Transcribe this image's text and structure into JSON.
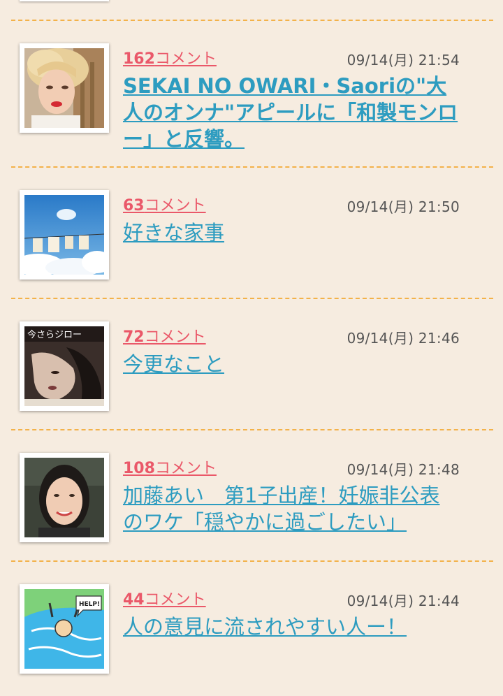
{
  "articles": [
    {
      "comment_count": "162",
      "comment_unit": "コメント",
      "datetime": "09/14(月) 21:54",
      "title": "SEKAI NO OWARI・Saoriの\"大人のオンナ\"アピールに「和製モンロー」と反響。",
      "thumb_icon": "woman-blonde-portrait-thumbnail"
    },
    {
      "comment_count": "63",
      "comment_unit": "コメント",
      "datetime": "09/14(月) 21:50",
      "title": "好きな家事",
      "thumb_icon": "laundry-sky-thumbnail"
    },
    {
      "comment_count": "72",
      "comment_unit": "コメント",
      "datetime": "09/14(月) 21:46",
      "title": "今更なこと",
      "thumb_icon": "record-cover-thumbnail"
    },
    {
      "comment_count": "108",
      "comment_unit": "コメント",
      "datetime": "09/14(月) 21:48",
      "title": "加藤あい　第1子出産！妊娠非公表のワケ「穏やかに過ごしたい」",
      "thumb_icon": "woman-smiling-portrait-thumbnail"
    },
    {
      "comment_count": "44",
      "comment_unit": "コメント",
      "datetime": "09/14(月) 21:44",
      "title": "人の意見に流されやすい人ー！",
      "thumb_icon": "drowning-help-illustration-thumbnail"
    }
  ],
  "thumb_texts": {
    "record_title": "今さらジロー",
    "help_text": "HELP!"
  },
  "colors": {
    "background": "#f6ece0",
    "divider": "#f3b24a",
    "comment": "#ea5869",
    "title_link": "#2d9cc0",
    "date": "#555555"
  }
}
